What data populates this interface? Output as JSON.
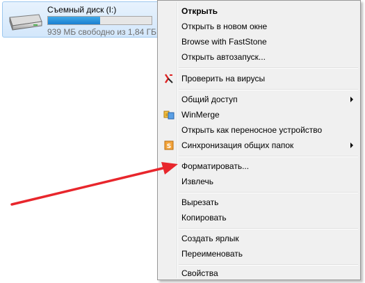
{
  "drive": {
    "name": "Съемный диск (I:)",
    "free_text": "939 МБ свободно из 1,84 ГБ",
    "used_fraction": 0.5
  },
  "menu": {
    "open": "Открыть",
    "open_new_window": "Открыть в новом окне",
    "browse_faststone": "Browse with FastStone",
    "open_autoplay": "Открыть автозапуск...",
    "scan_viruses": "Проверить на вирусы",
    "sharing": "Общий доступ",
    "winmerge": "WinMerge",
    "open_portable": "Открыть как переносное устройство",
    "sync_folders": "Синхронизация общих папок",
    "format": "Форматировать...",
    "eject": "Извлечь",
    "cut": "Вырезать",
    "copy": "Копировать",
    "create_shortcut": "Создать ярлык",
    "rename": "Переименовать",
    "properties": "Свойства"
  },
  "colors": {
    "accent_arrow": "#e8262c",
    "menu_bg": "#f0f0f0",
    "selection_bg": "#d3e7fb"
  },
  "icons": {
    "drive": "usb-drive-icon",
    "antivirus": "kaspersky-icon",
    "winmerge": "winmerge-icon",
    "sync": "sync-folders-icon"
  }
}
